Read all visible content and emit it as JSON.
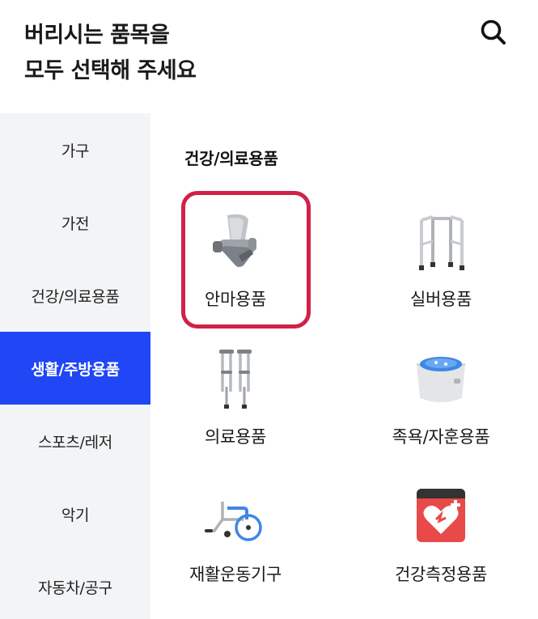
{
  "header": {
    "title_line1": "버리시는 품목을",
    "title_line2": "모두 선택해 주세요"
  },
  "sidebar": {
    "items": [
      {
        "label": "가구"
      },
      {
        "label": "가전"
      },
      {
        "label": "건강/의료용품"
      },
      {
        "label": "생활/주방용품",
        "active": true
      },
      {
        "label": "스포츠/레저"
      },
      {
        "label": "악기"
      },
      {
        "label": "자동차/공구"
      }
    ]
  },
  "content": {
    "section_title": "건강/의료용품",
    "items": [
      {
        "label": "안마용품",
        "icon": "massage-chair-icon",
        "selected": true
      },
      {
        "label": "실버용품",
        "icon": "walker-icon"
      },
      {
        "label": "의료용품",
        "icon": "crutches-icon"
      },
      {
        "label": "족욕/자훈용품",
        "icon": "foot-spa-icon"
      },
      {
        "label": "재활운동기구",
        "icon": "wheelchair-icon"
      },
      {
        "label": "건강측정용품",
        "icon": "heart-monitor-icon"
      }
    ]
  },
  "colors": {
    "accent": "#2046f5",
    "selected_border": "#d12148",
    "sidebar_bg": "#f3f4f6"
  }
}
